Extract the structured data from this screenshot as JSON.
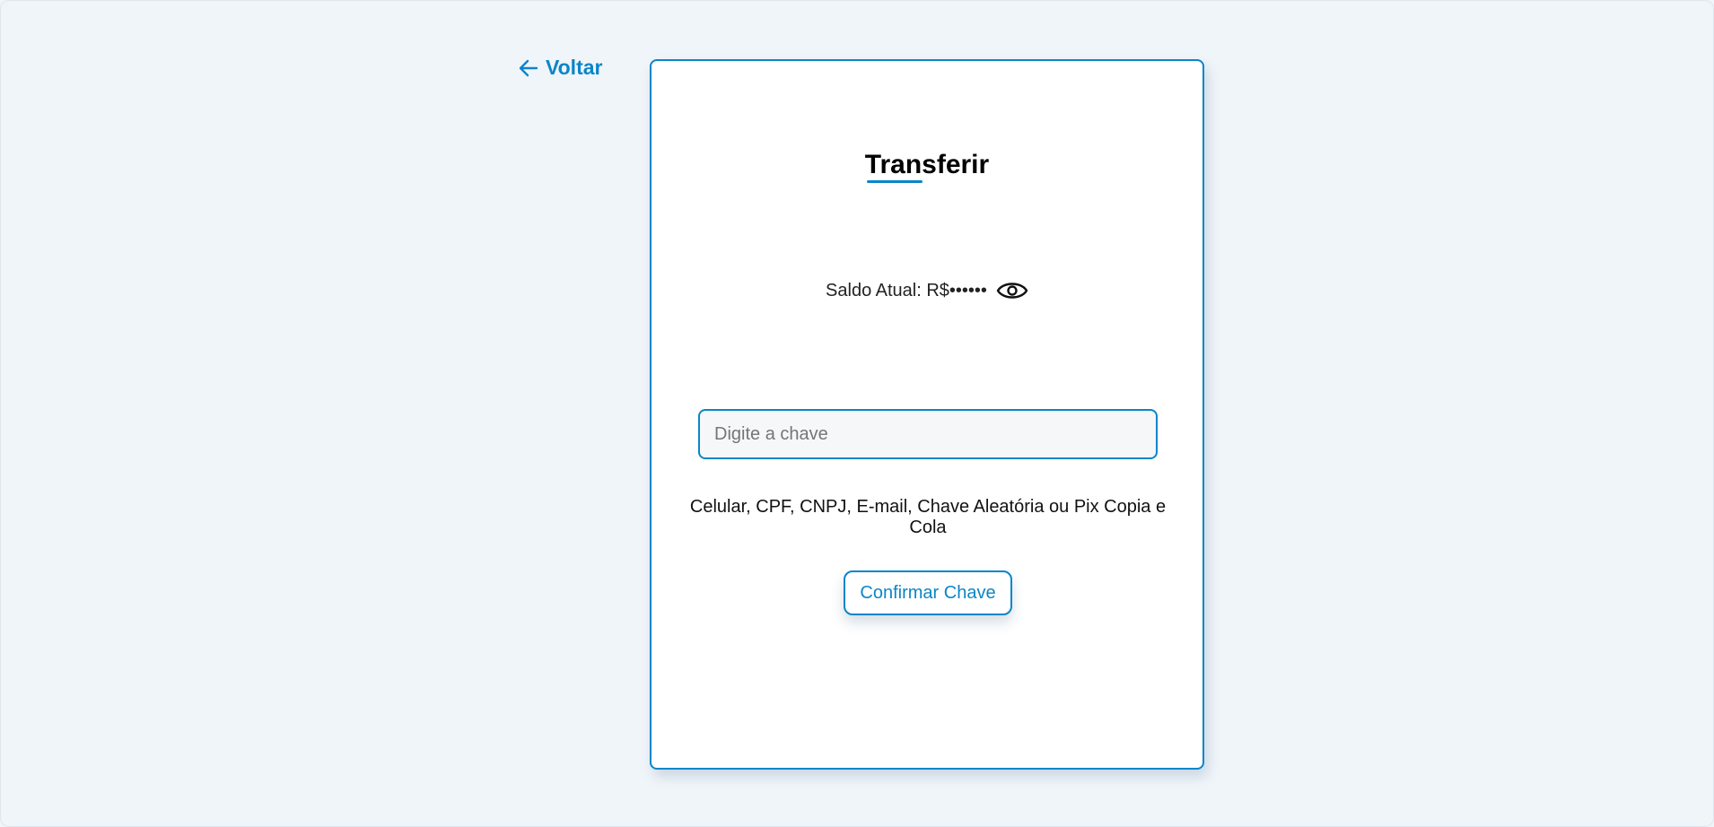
{
  "nav": {
    "back_label": "Voltar",
    "back_icon": "arrow-left-icon"
  },
  "card": {
    "title": "Transferir",
    "balance_text": "Saldo Atual: R$••••••",
    "balance_icon": "eye-icon",
    "key_input": {
      "value": "",
      "placeholder": "Digite a chave"
    },
    "hint": "Celular, CPF, CNPJ, E-mail, Chave Aleatória ou Pix Copia e Cola",
    "confirm_label": "Confirmar Chave"
  },
  "colors": {
    "accent": "#0b85c9",
    "background": "#f0f5f9",
    "card": "#ffffff"
  }
}
